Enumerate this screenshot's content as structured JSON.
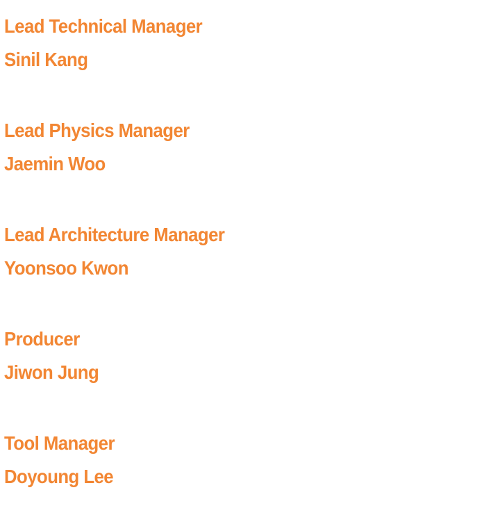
{
  "colors": {
    "text": "#f28633",
    "background": "#ffffff"
  },
  "credits": [
    {
      "role": "Lead Technical Manager",
      "name": "Sinil Kang"
    },
    {
      "role": "Lead Physics Manager",
      "name": "Jaemin Woo"
    },
    {
      "role": "Lead Architecture Manager",
      "name": "Yoonsoo Kwon"
    },
    {
      "role": "Producer",
      "name": "Jiwon Jung"
    },
    {
      "role": "Tool Manager",
      "name": "Doyoung Lee"
    }
  ]
}
